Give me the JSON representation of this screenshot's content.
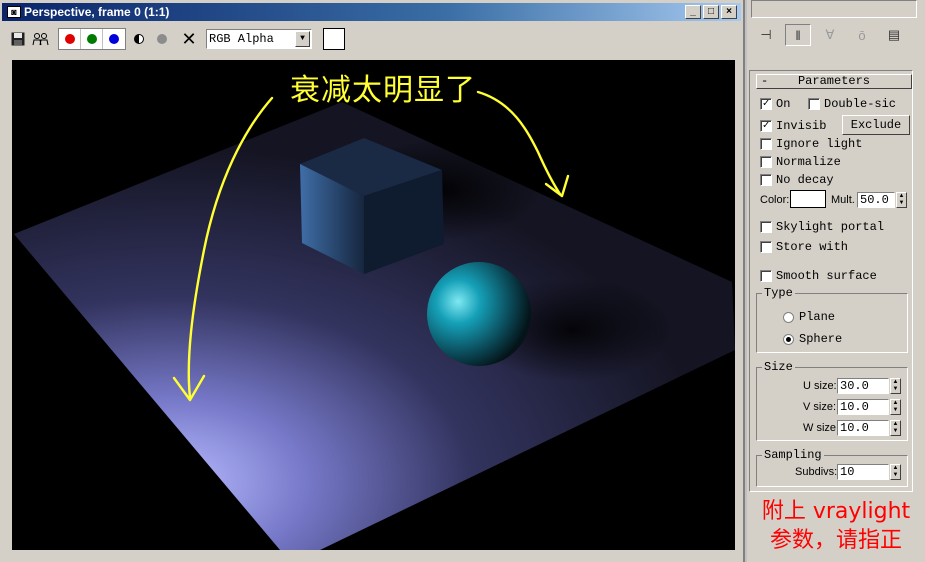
{
  "window": {
    "title": "Perspective, frame 0 (1:1)",
    "app_icon": "render-frame-icon",
    "buttons": {
      "minimize": "_",
      "maximize": "□",
      "close": "×"
    }
  },
  "toolbar": {
    "save_icon": "save-icon",
    "clone_icon": "clone-icon",
    "channels": [
      {
        "name": "red-channel",
        "color": "#e00000"
      },
      {
        "name": "green-channel",
        "color": "#007a00"
      },
      {
        "name": "blue-channel",
        "color": "#0000dd"
      }
    ],
    "mono_icon": "monochrome-icon",
    "alpha_icon": "alpha-dot-icon",
    "clear_label": "✕",
    "channel_select": "RGB Alpha",
    "swatch_color": "#ffffff"
  },
  "viewport": {
    "annotation_top": "衰减太明显了",
    "annotation_color": "#ffff33"
  },
  "command_panel": {
    "icons": [
      "pin-stack-icon",
      "show-end-result-icon",
      "make-unique-icon",
      "remove-modifier-icon",
      "configure-sets-icon"
    ],
    "rollout_title": "Parameters",
    "rollout_toggle": "-",
    "on": {
      "label": "On",
      "checked": true
    },
    "double_sided": {
      "label": "Double-sic",
      "checked": false
    },
    "invisible": {
      "label": "Invisib",
      "checked": true
    },
    "exclude_label": "Exclude",
    "ignore_light": {
      "label": "Ignore light",
      "checked": false
    },
    "normalize": {
      "label": "Normalize",
      "checked": false
    },
    "no_decay": {
      "label": "No decay",
      "checked": false
    },
    "color_label": "Color:",
    "color_value": "#ffffff",
    "mult_label": "Mult.",
    "mult_value": "50.0",
    "skylight_portal": {
      "label": "Skylight portal",
      "checked": false
    },
    "store_with": {
      "label": "Store with",
      "checked": false
    },
    "smooth_surface": {
      "label": "Smooth surface",
      "checked": false
    },
    "type": {
      "label": "Type",
      "options": [
        {
          "label": "Plane",
          "selected": false
        },
        {
          "label": "Sphere",
          "selected": true
        }
      ]
    },
    "size": {
      "label": "Size",
      "fields": [
        {
          "label": "U size:",
          "value": "30.0"
        },
        {
          "label": "V size:",
          "value": "10.0"
        },
        {
          "label": "W size:",
          "value": "10.0"
        }
      ]
    },
    "sampling": {
      "label": "Sampling",
      "subdivs_label": "Subdivs:",
      "subdivs_value": "10"
    },
    "note_line1": "附上 vraylight",
    "note_line2": "参数，请指正",
    "note_color": "#ff0000"
  }
}
